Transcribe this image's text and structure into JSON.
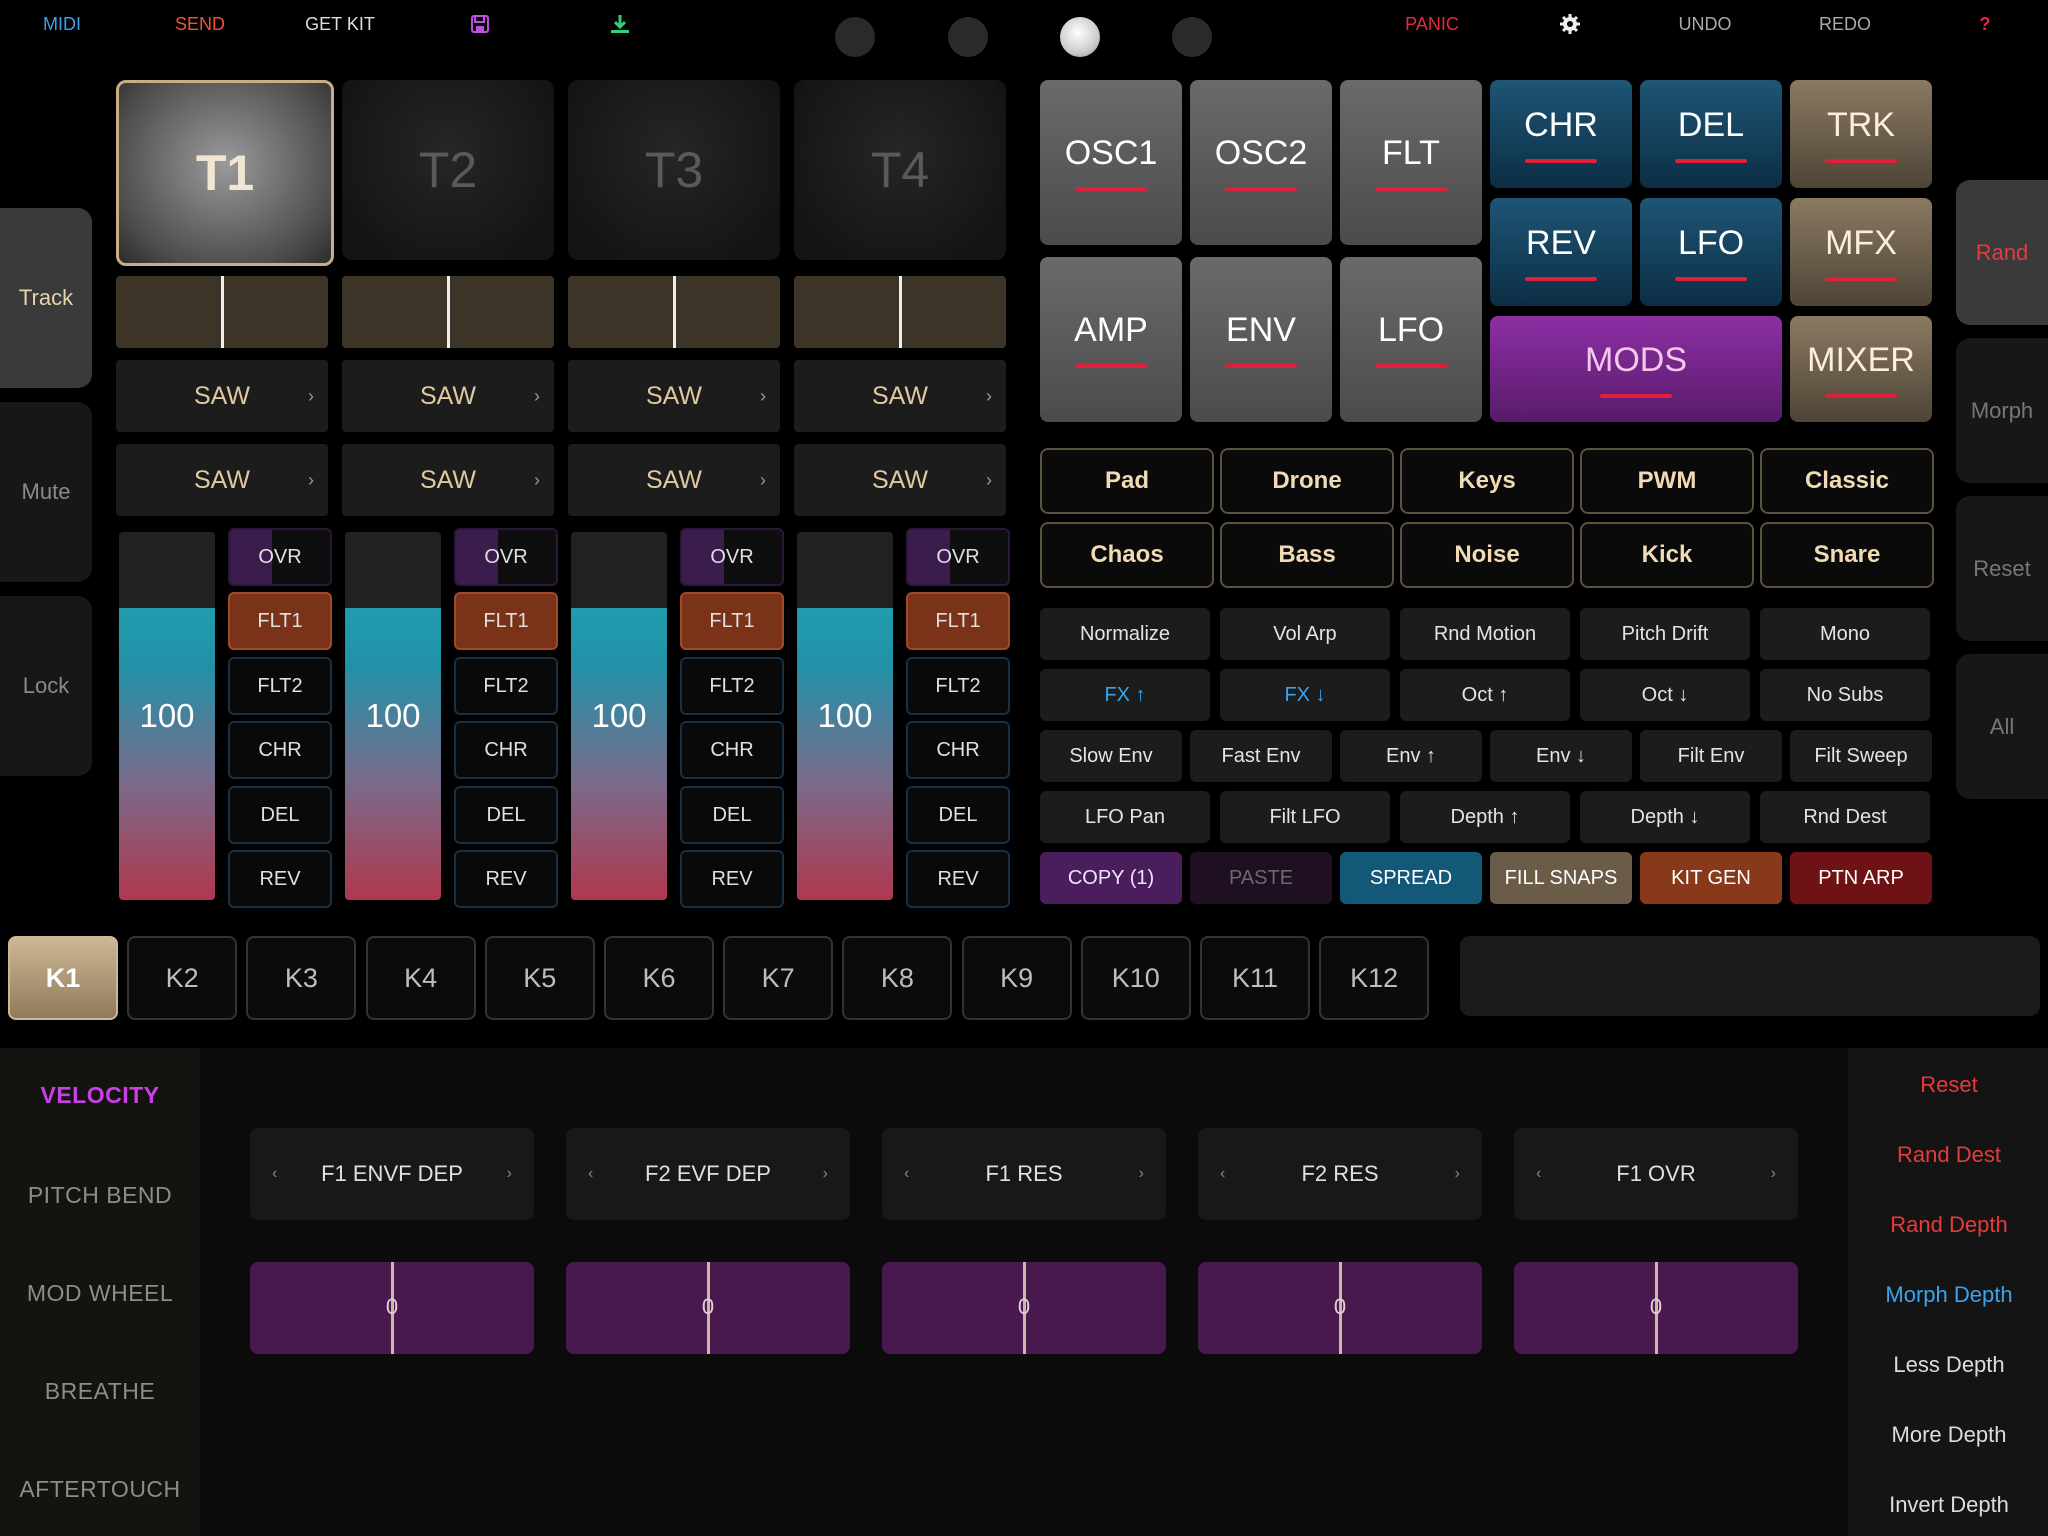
{
  "topbar": {
    "midi": "MIDI",
    "send": "SEND",
    "get_kit": "GET KIT",
    "save_icon": "💾",
    "download_icon": "⬇",
    "panic": "PANIC",
    "settings_icon": "⚙",
    "undo": "UNDO",
    "redo": "REDO",
    "help": "?"
  },
  "left_tabs": [
    "Track",
    "Mute",
    "Lock"
  ],
  "tracks": [
    {
      "name": "T1",
      "osc1": "SAW",
      "osc2": "SAW",
      "level": "100",
      "chev": "›"
    },
    {
      "name": "T2",
      "osc1": "SAW",
      "osc2": "SAW",
      "level": "100",
      "chev": "›"
    },
    {
      "name": "T3",
      "osc1": "SAW",
      "osc2": "SAW",
      "level": "100",
      "chev": "›"
    },
    {
      "name": "T4",
      "osc1": "SAW",
      "osc2": "SAW",
      "level": "100",
      "chev": "›"
    }
  ],
  "fx_toggles": [
    "OVR",
    "FLT1",
    "FLT2",
    "CHR",
    "DEL",
    "REV"
  ],
  "modules": {
    "osc1": "OSC1",
    "osc2": "OSC2",
    "flt": "FLT",
    "chr": "CHR",
    "del": "DEL",
    "trk": "TRK",
    "rev": "REV",
    "lfo_fx": "LFO",
    "mfx": "MFX",
    "amp": "AMP",
    "env": "ENV",
    "lfo": "LFO",
    "mods": "MODS",
    "mixer": "MIXER"
  },
  "right_tabs": [
    "Rand",
    "Morph",
    "Reset",
    "All"
  ],
  "presets_row1": [
    "Pad",
    "Drone",
    "Keys",
    "PWM",
    "Classic"
  ],
  "presets_row2": [
    "Chaos",
    "Bass",
    "Noise",
    "Kick",
    "Snare"
  ],
  "actions_row1": [
    "Normalize",
    "Vol Arp",
    "Rnd Motion",
    "Pitch Drift",
    "Mono"
  ],
  "actions_row2": [
    "FX ↑",
    "FX ↓",
    "Oct ↑",
    "Oct ↓",
    "No Subs"
  ],
  "actions_row3": [
    "Slow Env",
    "Fast Env",
    "Env ↑",
    "Env ↓",
    "Filt Env",
    "Filt Sweep"
  ],
  "actions_row4": [
    "LFO Pan",
    "Filt LFO",
    "Depth ↑",
    "Depth ↓",
    "Rnd Dest"
  ],
  "actions_row5": [
    "COPY (1)",
    "PASTE",
    "SPREAD",
    "FILL SNAPS",
    "KIT GEN",
    "PTN ARP"
  ],
  "kits": [
    "K1",
    "K2",
    "K3",
    "K4",
    "K5",
    "K6",
    "K7",
    "K8",
    "K9",
    "K10",
    "K11",
    "K12"
  ],
  "mod_sources": [
    "VELOCITY",
    "PITCH BEND",
    "MOD WHEEL",
    "BREATHE",
    "AFTERTOUCH"
  ],
  "mod_destinations": [
    {
      "label": "F1 ENVF DEP",
      "depth": "0",
      "l": "‹",
      "r": "›"
    },
    {
      "label": "F2 EVF DEP",
      "depth": "0",
      "l": "‹",
      "r": "›"
    },
    {
      "label": "F1 RES",
      "depth": "0",
      "l": "‹",
      "r": "›"
    },
    {
      "label": "F2 RES",
      "depth": "0",
      "l": "‹",
      "r": "›"
    },
    {
      "label": "F1 OVR",
      "depth": "0",
      "l": "‹",
      "r": "›"
    }
  ],
  "mod_actions": [
    "Reset",
    "Rand Dest",
    "Rand Depth",
    "Morph Depth",
    "Less Depth",
    "More Depth",
    "Invert Depth"
  ],
  "colors": {
    "accent_red": "#e63b3b",
    "blue": "#3ba3ec",
    "purple": "#c941e6",
    "gold": "#cdb795"
  }
}
